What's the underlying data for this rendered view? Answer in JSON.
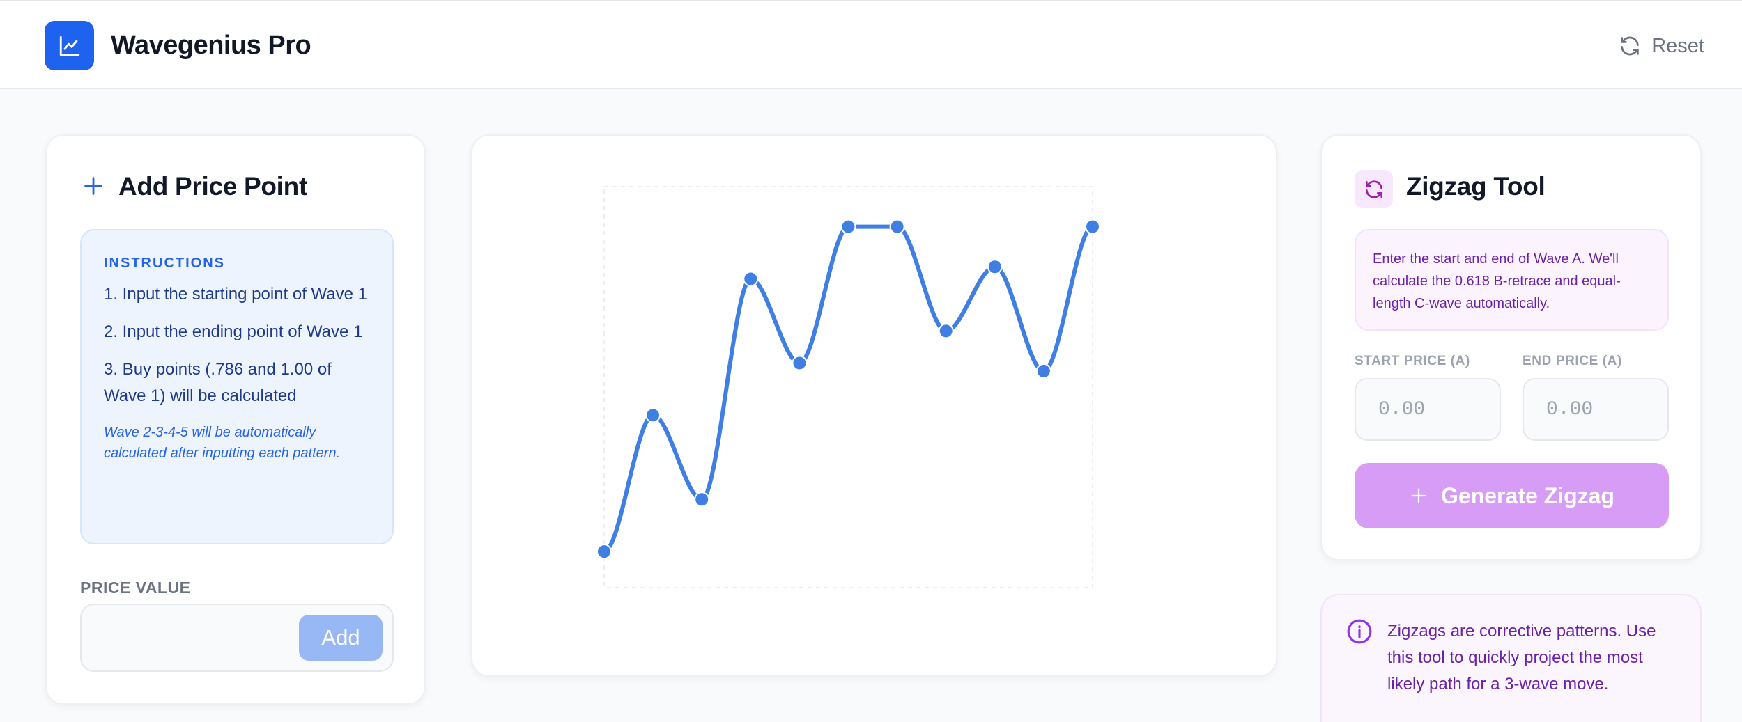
{
  "header": {
    "app_title": "Wavegenius Pro",
    "logo_icon": "line-chart-icon",
    "reset_label": "Reset",
    "reset_icon": "refresh-icon"
  },
  "add_price_point": {
    "title": "Add Price Point",
    "icon": "plus-icon",
    "instructions": {
      "title": "INSTRUCTIONS",
      "steps": [
        "1. Input the starting point of Wave 1",
        "2. Input the ending point of Wave 1",
        "3. Buy points (.786 and 1.00 of Wave 1) will be calculated"
      ],
      "note": "Wave 2-3-4-5 will be automatically calculated after inputting each pattern."
    },
    "price_label": "PRICE VALUE",
    "price_value": "",
    "add_label": "Add"
  },
  "chart_data": {
    "type": "line",
    "x": [
      0,
      1,
      2,
      3,
      4,
      5,
      6,
      7,
      8,
      9,
      10
    ],
    "values": [
      0.09,
      0.43,
      0.22,
      0.77,
      0.56,
      0.9,
      0.9,
      0.64,
      0.8,
      0.54,
      0.9
    ],
    "ylim": [
      0,
      1
    ],
    "title": "",
    "xlabel": "",
    "ylabel": "",
    "grid": false,
    "line_color": "#3f7fe3",
    "frame": "dashed"
  },
  "zigzag": {
    "title": "Zigzag Tool",
    "icon": "refresh-icon",
    "description": "Enter the start and end of Wave A. We'll calculate the 0.618 B-retrace and equal-length C-wave automatically.",
    "start_label": "START PRICE (A)",
    "start_placeholder": "0.00",
    "end_label": "END PRICE (A)",
    "end_placeholder": "0.00",
    "generate_label": "Generate Zigzag",
    "accent": "#d79cf5"
  },
  "info": {
    "icon": "info-icon",
    "text": "Zigzags are corrective patterns. Use this tool to quickly project the most likely path for a 3-wave move."
  },
  "colors": {
    "brand": "#1d63f0",
    "purple_text": "#6b21a8",
    "blue_text": "#1e3a8a"
  }
}
